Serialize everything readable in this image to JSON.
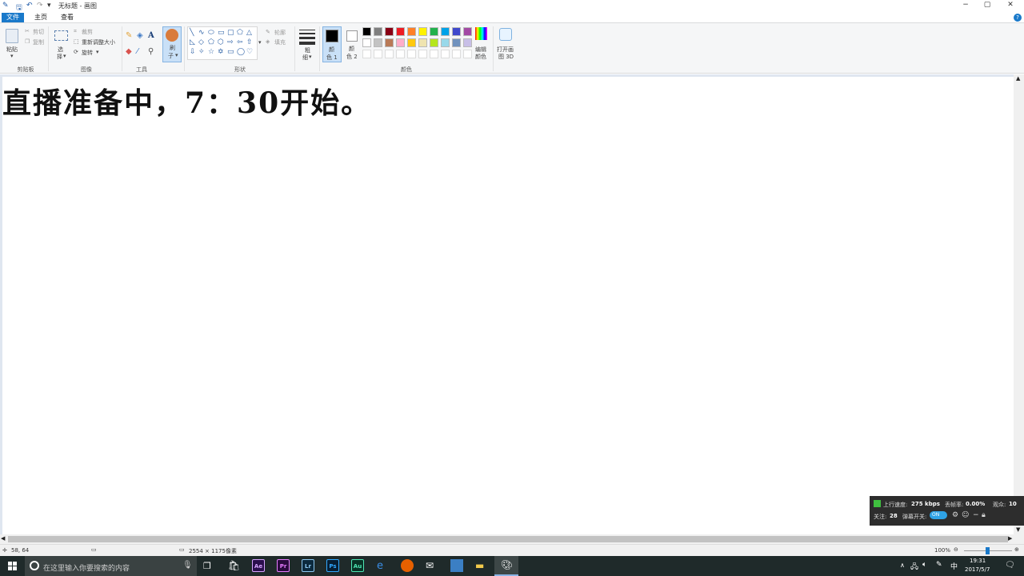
{
  "titlebar": {
    "title": "无标题 - 画图",
    "min": "−",
    "max": "▢",
    "close": "✕"
  },
  "tabs": {
    "file": "文件",
    "home": "主页",
    "view": "查看"
  },
  "ribbon": {
    "clipboard": {
      "paste": "粘贴",
      "cut": "剪切",
      "copy": "复制",
      "label": "剪贴板"
    },
    "image": {
      "select_1": "选",
      "select_2": "择",
      "crop": "裁剪",
      "resize": "重新调整大小",
      "rotate": "旋转",
      "label": "图像"
    },
    "tools": {
      "label": "工具",
      "brush_1": "刷",
      "brush_2": "子"
    },
    "shapes": {
      "outline": "轮廓",
      "fill": "填充",
      "label": "形状"
    },
    "size": {
      "l1": "粗",
      "l2": "细"
    },
    "color1": {
      "l1": "颜",
      "l2": "色 1"
    },
    "color2": {
      "l1": "颜",
      "l2": "色 2"
    },
    "colors_label": "颜色",
    "edit_colors": {
      "l1": "编辑",
      "l2": "颜色"
    },
    "paint3d": {
      "l1": "打开画",
      "l2": "图 3D"
    },
    "palette_row1": [
      "#000000",
      "#7f7f7f",
      "#880015",
      "#ed1c24",
      "#ff7f27",
      "#fff200",
      "#22b14c",
      "#00a2e8",
      "#3f48cc",
      "#a349a4"
    ],
    "palette_row2": [
      "#ffffff",
      "#c3c3c3",
      "#b97a57",
      "#ffaec9",
      "#ffc90e",
      "#efe4b0",
      "#b5e61d",
      "#99d9ea",
      "#7092be",
      "#c8bfe7"
    ]
  },
  "canvas": {
    "text": "直播准备中，7：30开始。"
  },
  "status": {
    "cursor": "58, 64",
    "size": "2554 × 1175像素",
    "zoom": "100%"
  },
  "overlay": {
    "upload_label": "上行速度:",
    "upload_value": "275 kbps",
    "drop_label": "丢帧率:",
    "drop_value": "0.00%",
    "viewers_label": "观众:",
    "viewers_value": "10",
    "follow_label": "关注:",
    "follow_value": "28",
    "danmaku_label": "弹幕开关:",
    "danmaku_state": "ON"
  },
  "taskbar": {
    "search_placeholder": "在这里输入你要搜索的内容",
    "apps": [
      {
        "name": "Ae",
        "color": "#2b0e4d",
        "fg": "#d7a5ff"
      },
      {
        "name": "Pr",
        "color": "#2a0a3e",
        "fg": "#e77cff"
      },
      {
        "name": "Lr",
        "color": "#0c2a3e",
        "fg": "#8ec9f2"
      },
      {
        "name": "Ps",
        "color": "#071e33",
        "fg": "#31a8ff"
      },
      {
        "name": "Au",
        "color": "#083326",
        "fg": "#4ee6b3"
      }
    ],
    "ime": "中",
    "time": "19:31",
    "date": "2017/5/7"
  }
}
